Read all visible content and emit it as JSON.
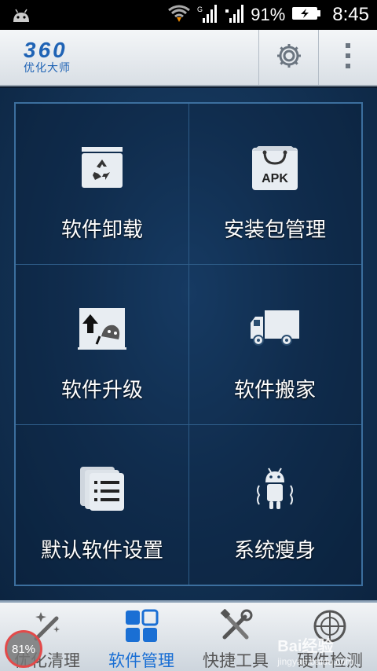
{
  "status_bar": {
    "battery_percent": "91%",
    "time": "8:45",
    "network_label": "G"
  },
  "header": {
    "logo_main": "360",
    "logo_sub": "优化大师",
    "settings_icon": "gear-icon",
    "menu_icon": "overflow-menu-icon"
  },
  "grid": {
    "items": [
      {
        "label": "软件卸载",
        "icon": "recycle-icon"
      },
      {
        "label": "安装包管理",
        "icon": "apk-bag-icon",
        "icon_text": "APK"
      },
      {
        "label": "软件升级",
        "icon": "upgrade-icon"
      },
      {
        "label": "软件搬家",
        "icon": "truck-icon"
      },
      {
        "label": "默认软件设置",
        "icon": "list-settings-icon"
      },
      {
        "label": "系统瘦身",
        "icon": "android-slim-icon"
      }
    ]
  },
  "bottom_nav": {
    "tabs": [
      {
        "label": "优化清理",
        "icon": "magic-wand-icon",
        "active": false
      },
      {
        "label": "软件管理",
        "icon": "app-grid-icon",
        "active": true
      },
      {
        "label": "快捷工具",
        "icon": "tools-icon",
        "active": false
      },
      {
        "label": "硬件检测",
        "icon": "target-icon",
        "active": false
      }
    ]
  },
  "memory_badge": "81%",
  "watermark": {
    "brand": "Bai",
    "sub": "jingyan.baidu.com",
    "tail": "经验"
  },
  "colors": {
    "brand_blue": "#1f63b5",
    "active_tab": "#1a6fd4",
    "panel_bg": "#143559"
  }
}
